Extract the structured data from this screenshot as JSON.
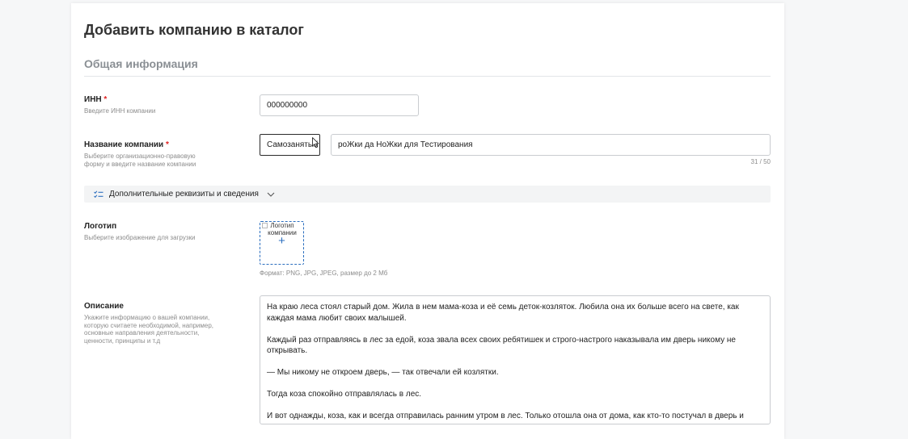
{
  "page": {
    "title": "Добавить компанию в каталог"
  },
  "section": {
    "title": "Общая информация"
  },
  "inn": {
    "label": "ИНН",
    "required_mark": "*",
    "hint": "Введите ИНН компании",
    "value": "000000000"
  },
  "company_name": {
    "label": "Название компании",
    "required_mark": "*",
    "hint": "Выберите организационно-правовую форму и введите название компании",
    "legal_form": "Самозанятый",
    "value": "роЖки да НоЖки для Тестирования",
    "counter": "31 / 50"
  },
  "details": {
    "label": "Дополнительные реквизиты и сведения"
  },
  "logo": {
    "label": "Логотип",
    "hint": "Выберите изображение для загрузки",
    "alt_text": "Логотип компании",
    "plus": "+",
    "format_note": "Формат: PNG, JPG, JPEG, размер до 2 Мб"
  },
  "description": {
    "label": "Описание",
    "hint": "Укажите информацию о вашей компании, которую считаете необходимой, например, основные направления деятельности, ценности, принципы и т.д",
    "paragraphs": [
      "На краю леса стоял старый дом. Жила в нем мама-коза и её семь деток-козляток. Любила она их больше всего на свете, как каждая мама любит своих малышей.",
      "Каждый раз отправляясь в лес за едой, коза звала всех своих ребятишек и строго-настрого наказывала им дверь никому не открывать.",
      "— Мы никому не откроем дверь, — так отвечали ей козлятки.",
      "Тогда коза спокойно отправлялась в лес.",
      "И вот однажды, коза, как и всегда отправилась ранним утром в лес. Только отошла она от дома, как кто-то постучал в дверь и сказал:"
    ]
  },
  "colors": {
    "accent": "#2c6fbf",
    "required": "#e02020",
    "hint": "#8c8c8c",
    "section_title": "#8a8f94"
  },
  "icons": {
    "details": "checklist-icon",
    "expand": "chevron-down-icon",
    "cursor": "mouse-pointer-icon",
    "broken_image": "broken-image-icon"
  }
}
